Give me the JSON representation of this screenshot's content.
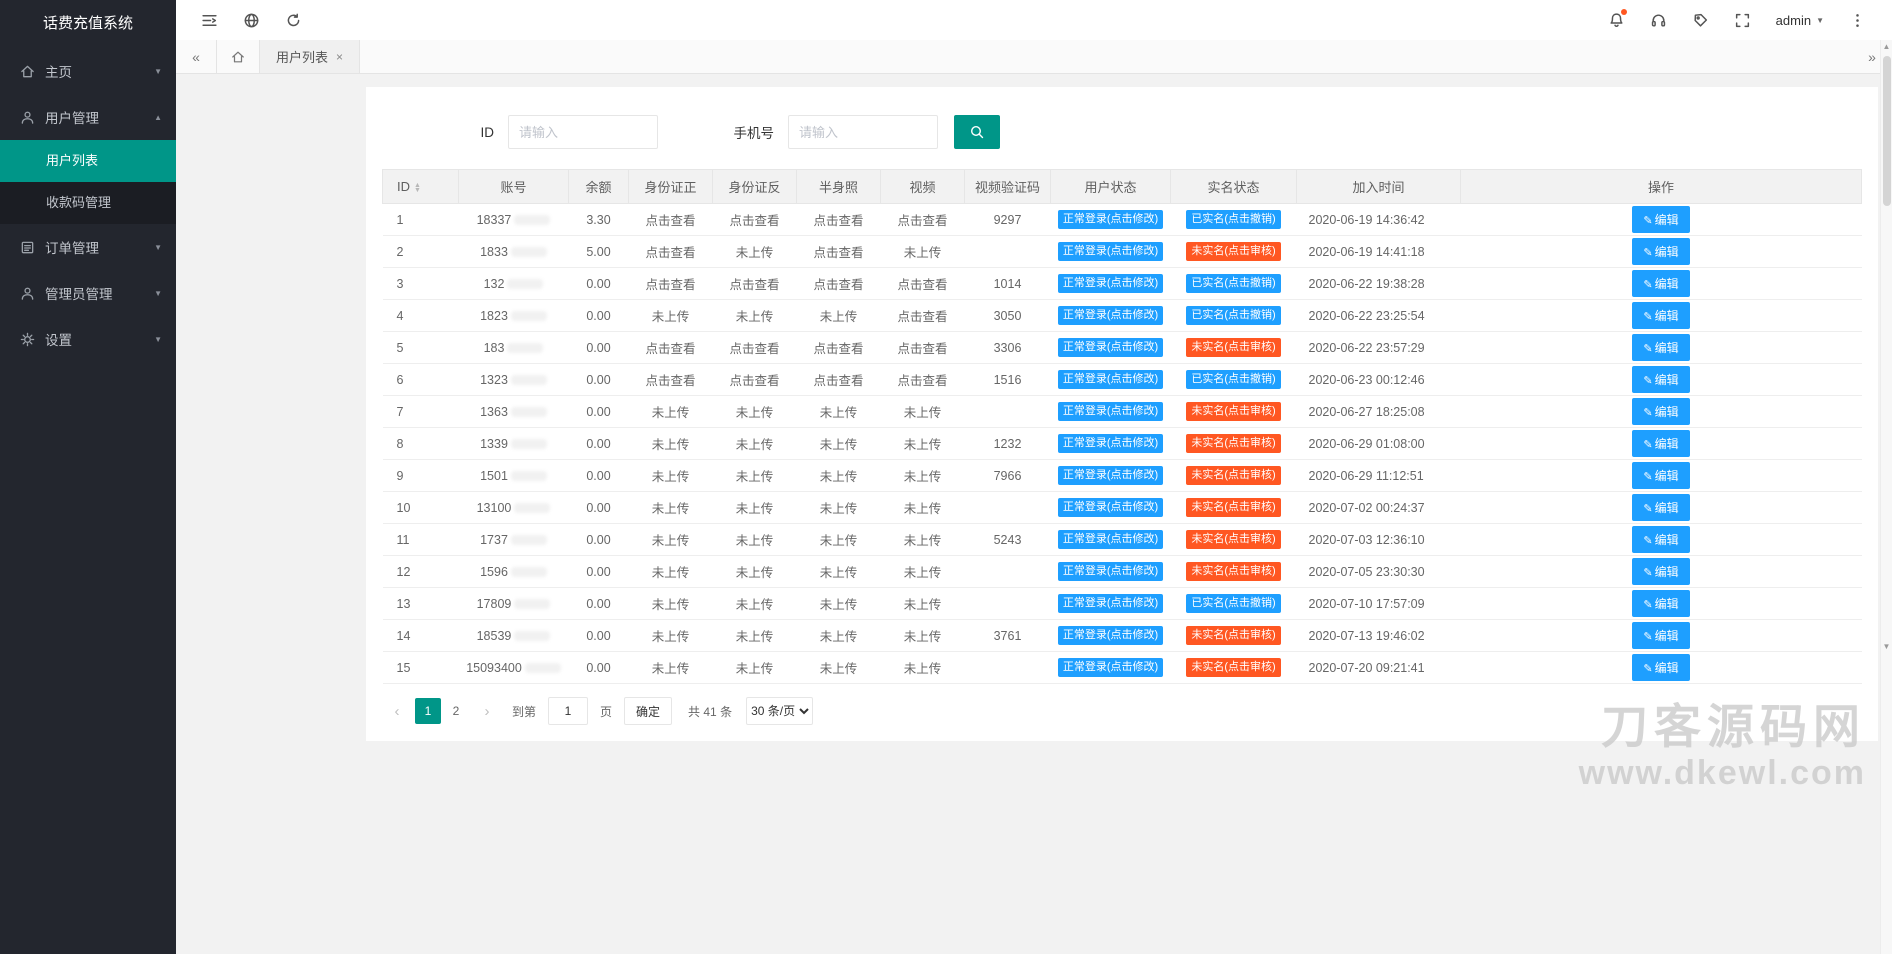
{
  "app": {
    "title": "话费充值系统"
  },
  "topbar": {
    "admin_label": "admin"
  },
  "sidebar": {
    "home": "主页",
    "user_mgmt": "用户管理",
    "user_list": "用户列表",
    "payment_codes": "收款码管理",
    "order_mgmt": "订单管理",
    "admin_mgmt": "管理员管理",
    "settings": "设置"
  },
  "tabs": {
    "active_label": "用户列表"
  },
  "search": {
    "id_label": "ID",
    "id_placeholder": "请输入",
    "phone_label": "手机号",
    "phone_placeholder": "请输入"
  },
  "table": {
    "headers": [
      "ID",
      "账号",
      "余额",
      "身份证正",
      "身份证反",
      "半身照",
      "视频",
      "视频验证码",
      "用户状态",
      "实名状态",
      "加入时间",
      "操作"
    ],
    "status_labels": {
      "view": "点击查看",
      "not_uploaded": "未上传",
      "user_status": "正常登录(点击修改)",
      "real_verified": "已实名(点击撤销)",
      "real_unverified": "未实名(点击审核)",
      "edit": "编辑"
    },
    "rows": [
      {
        "id": "1",
        "account": "18337",
        "balance": "3.30",
        "id_front": "点击查看",
        "id_back": "点击查看",
        "half_photo": "点击查看",
        "video": "点击查看",
        "video_code": "9297",
        "real": "verified",
        "join_time": "2020-06-19 14:36:42"
      },
      {
        "id": "2",
        "account": "1833",
        "balance": "5.00",
        "id_front": "点击查看",
        "id_back": "未上传",
        "half_photo": "点击查看",
        "video": "未上传",
        "video_code": "",
        "real": "unverified",
        "join_time": "2020-06-19 14:41:18"
      },
      {
        "id": "3",
        "account": "132",
        "balance": "0.00",
        "id_front": "点击查看",
        "id_back": "点击查看",
        "half_photo": "点击查看",
        "video": "点击查看",
        "video_code": "1014",
        "real": "verified",
        "join_time": "2020-06-22 19:38:28"
      },
      {
        "id": "4",
        "account": "1823",
        "balance": "0.00",
        "id_front": "未上传",
        "id_back": "未上传",
        "half_photo": "未上传",
        "video": "点击查看",
        "video_code": "3050",
        "real": "verified",
        "join_time": "2020-06-22 23:25:54"
      },
      {
        "id": "5",
        "account": "183",
        "balance": "0.00",
        "id_front": "点击查看",
        "id_back": "点击查看",
        "half_photo": "点击查看",
        "video": "点击查看",
        "video_code": "3306",
        "real": "unverified",
        "join_time": "2020-06-22 23:57:29"
      },
      {
        "id": "6",
        "account": "1323",
        "balance": "0.00",
        "id_front": "点击查看",
        "id_back": "点击查看",
        "half_photo": "点击查看",
        "video": "点击查看",
        "video_code": "1516",
        "real": "verified",
        "join_time": "2020-06-23 00:12:46"
      },
      {
        "id": "7",
        "account": "1363",
        "balance": "0.00",
        "id_front": "未上传",
        "id_back": "未上传",
        "half_photo": "未上传",
        "video": "未上传",
        "video_code": "",
        "real": "unverified",
        "join_time": "2020-06-27 18:25:08"
      },
      {
        "id": "8",
        "account": "1339",
        "balance": "0.00",
        "id_front": "未上传",
        "id_back": "未上传",
        "half_photo": "未上传",
        "video": "未上传",
        "video_code": "1232",
        "real": "unverified",
        "join_time": "2020-06-29 01:08:00"
      },
      {
        "id": "9",
        "account": "1501",
        "balance": "0.00",
        "id_front": "未上传",
        "id_back": "未上传",
        "half_photo": "未上传",
        "video": "未上传",
        "video_code": "7966",
        "real": "unverified",
        "join_time": "2020-06-29 11:12:51"
      },
      {
        "id": "10",
        "account": "13100",
        "balance": "0.00",
        "id_front": "未上传",
        "id_back": "未上传",
        "half_photo": "未上传",
        "video": "未上传",
        "video_code": "",
        "real": "unverified",
        "join_time": "2020-07-02 00:24:37"
      },
      {
        "id": "11",
        "account": "1737",
        "balance": "0.00",
        "id_front": "未上传",
        "id_back": "未上传",
        "half_photo": "未上传",
        "video": "未上传",
        "video_code": "5243",
        "real": "unverified",
        "join_time": "2020-07-03 12:36:10"
      },
      {
        "id": "12",
        "account": "1596",
        "balance": "0.00",
        "id_front": "未上传",
        "id_back": "未上传",
        "half_photo": "未上传",
        "video": "未上传",
        "video_code": "",
        "real": "unverified",
        "join_time": "2020-07-05 23:30:30"
      },
      {
        "id": "13",
        "account": "17809",
        "balance": "0.00",
        "id_front": "未上传",
        "id_back": "未上传",
        "half_photo": "未上传",
        "video": "未上传",
        "video_code": "",
        "real": "verified",
        "join_time": "2020-07-10 17:57:09"
      },
      {
        "id": "14",
        "account": "18539",
        "balance": "0.00",
        "id_front": "未上传",
        "id_back": "未上传",
        "half_photo": "未上传",
        "video": "未上传",
        "video_code": "3761",
        "real": "unverified",
        "join_time": "2020-07-13 19:46:02"
      },
      {
        "id": "15",
        "account": "15093400",
        "balance": "0.00",
        "id_front": "未上传",
        "id_back": "未上传",
        "half_photo": "未上传",
        "video": "未上传",
        "video_code": "",
        "real": "unverified",
        "join_time": "2020-07-20 09:21:41"
      }
    ]
  },
  "pagination": {
    "pages": [
      "1",
      "2"
    ],
    "current": "1",
    "goto_label": "到第",
    "goto_value": "1",
    "page_unit": "页",
    "confirm_label": "确定",
    "total_label": "共 41 条",
    "per_page": "30 条/页"
  },
  "watermark": {
    "line1": "刀客源码网",
    "line2": "www.dkewl.com"
  }
}
